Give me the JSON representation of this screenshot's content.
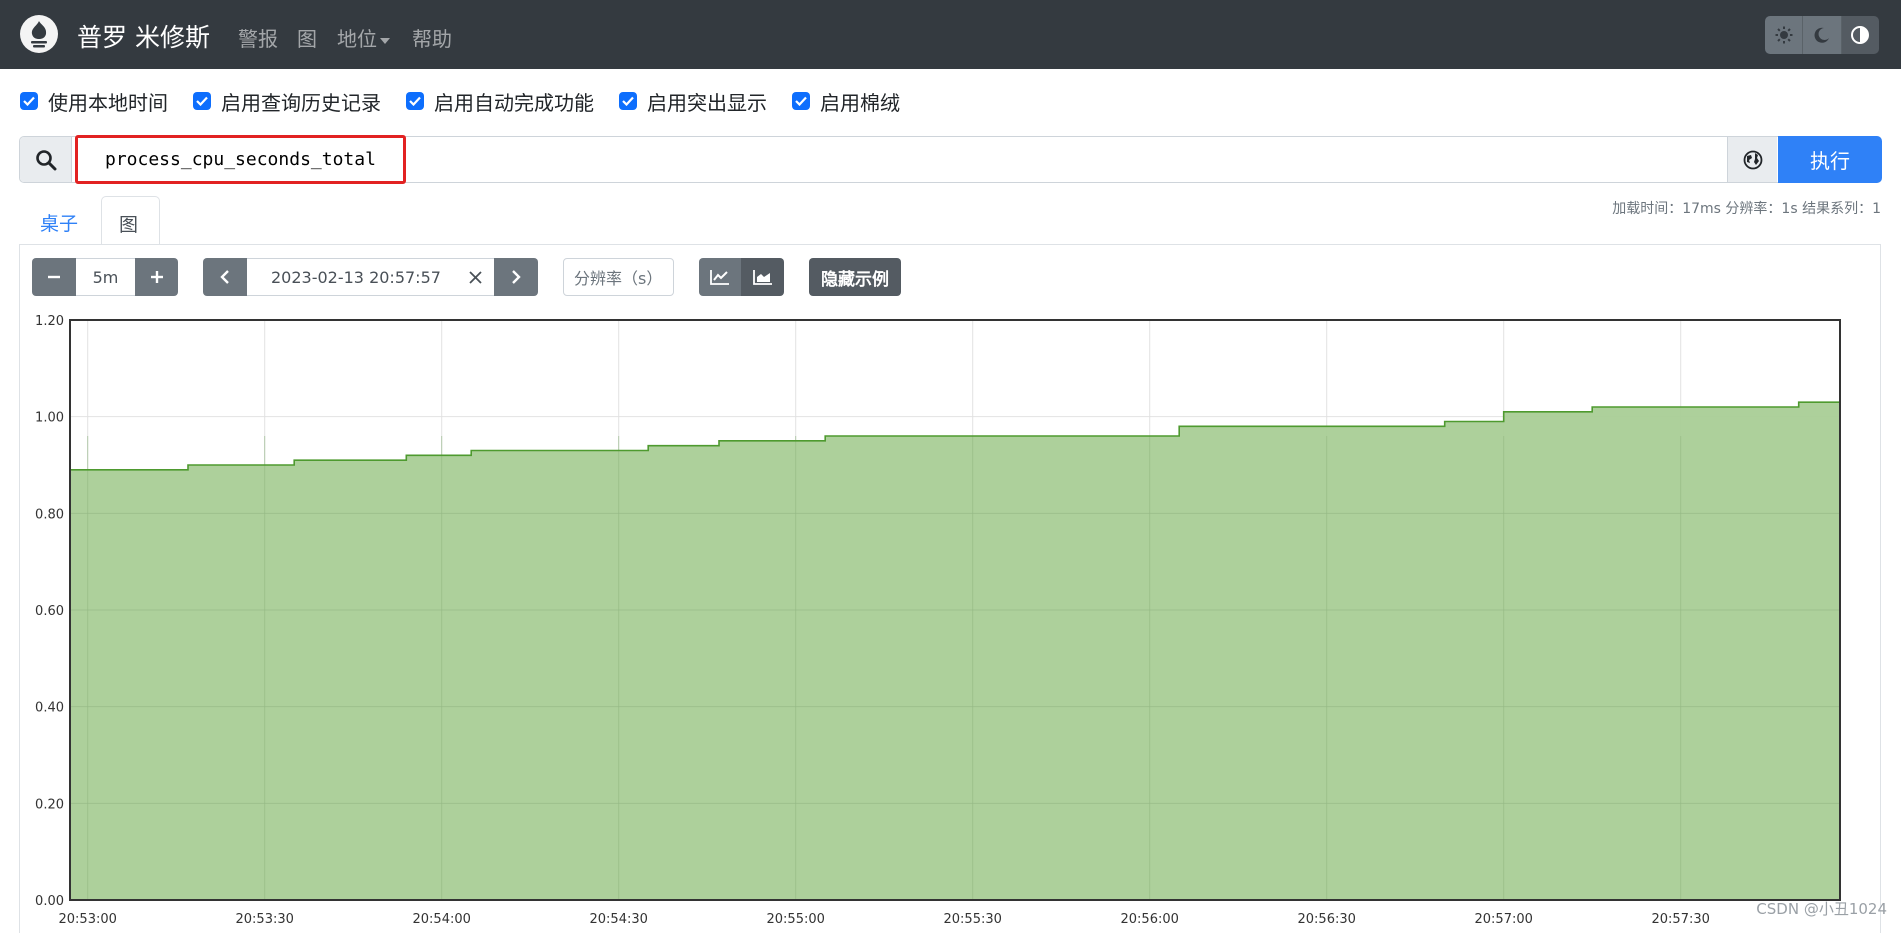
{
  "navbar": {
    "brand": "普罗 米修斯",
    "links": [
      {
        "label": "警报",
        "dropdown": false
      },
      {
        "label": "图",
        "dropdown": false
      },
      {
        "label": "地位",
        "dropdown": true
      },
      {
        "label": "帮助",
        "dropdown": false
      }
    ],
    "theme_buttons": [
      "sun-icon",
      "moon-icon",
      "contrast-icon"
    ]
  },
  "options": [
    {
      "label": "使用本地时间",
      "checked": true
    },
    {
      "label": "启用查询历史记录",
      "checked": true
    },
    {
      "label": "启用自动完成功能",
      "checked": true
    },
    {
      "label": "启用突出显示",
      "checked": true
    },
    {
      "label": "启用棉绒",
      "checked": true
    }
  ],
  "query": {
    "value": "process_cpu_seconds_total",
    "execute_label": "执行"
  },
  "tabs": [
    {
      "label": "桌子",
      "active": false
    },
    {
      "label": "图",
      "active": true
    }
  ],
  "stats": "加载时间：17ms 分辨率：1s 结果系列：1",
  "graph_controls": {
    "range": "5m",
    "end_time": "2023-02-13 20:57:57",
    "resolution_placeholder": "分辨率（s）",
    "hide_exemplars_label": "隐藏示例"
  },
  "colors": {
    "navbar_bg": "#343a40",
    "accent": "#2f81f7",
    "series_line": "#4e9a2f",
    "series_fill": "#a9cd96"
  },
  "chart_data": {
    "type": "area",
    "x": [
      "20:53:00",
      "20:53:17",
      "20:53:35",
      "20:53:54",
      "20:54:05",
      "20:54:12",
      "20:54:35",
      "20:54:47",
      "20:55:05",
      "20:55:17",
      "20:55:30",
      "20:55:45",
      "20:56:05",
      "20:56:30",
      "20:56:50",
      "20:57:00",
      "20:57:15",
      "20:57:30",
      "20:57:50",
      "20:57:57"
    ],
    "values": [
      0.89,
      0.9,
      0.91,
      0.92,
      0.93,
      0.93,
      0.94,
      0.95,
      0.96,
      0.96,
      0.96,
      0.96,
      0.98,
      0.98,
      0.99,
      1.01,
      1.02,
      1.02,
      1.03,
      1.03
    ],
    "step": "after",
    "x_ticks": [
      "20:53:00",
      "20:53:30",
      "20:54:00",
      "20:54:30",
      "20:55:00",
      "20:55:30",
      "20:56:00",
      "20:56:30",
      "20:57:00",
      "20:57:30"
    ],
    "y_ticks": [
      "0.00",
      "0.20",
      "0.40",
      "0.60",
      "0.80",
      "1.00",
      "1.20"
    ],
    "ylim": [
      0,
      1.2
    ],
    "xlim": [
      "20:52:57",
      "20:57:57"
    ],
    "grid": true,
    "title": "",
    "xlabel": "",
    "ylabel": ""
  },
  "watermark": "CSDN @小丑1024"
}
